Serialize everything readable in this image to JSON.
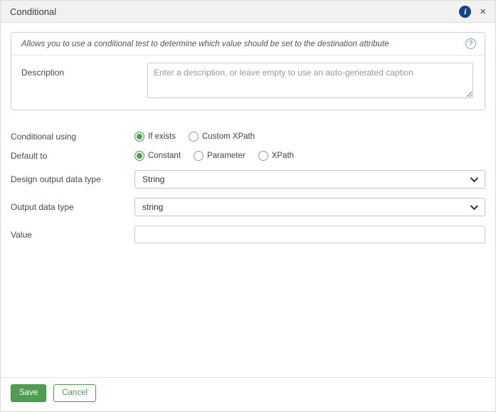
{
  "header": {
    "title": "Conditional"
  },
  "icons": {
    "info": "i",
    "close": "×",
    "help": "?"
  },
  "description_panel": {
    "hint": "Allows you to use a conditional test to determine which value should be set to the destination attribute",
    "label": "Description",
    "placeholder": "Enter a description, or leave empty to use an auto-generated caption"
  },
  "form": {
    "conditional_using": {
      "label": "Conditional using",
      "options": [
        {
          "label": "If exists",
          "selected": true
        },
        {
          "label": "Custom XPath",
          "selected": false
        }
      ]
    },
    "default_to": {
      "label": "Default to",
      "options": [
        {
          "label": "Constant",
          "selected": true
        },
        {
          "label": "Parameter",
          "selected": false
        },
        {
          "label": "XPath",
          "selected": false
        }
      ]
    },
    "design_output_data_type": {
      "label": "Design output data type",
      "value": "String"
    },
    "output_data_type": {
      "label": "Output data type",
      "value": "string"
    },
    "value_field": {
      "label": "Value",
      "value": ""
    }
  },
  "footer": {
    "save_label": "Save",
    "cancel_label": "Cancel"
  },
  "colors": {
    "accent_green": "#4f9d4f",
    "info_blue": "#17418c",
    "help_blue": "#739ed6"
  }
}
